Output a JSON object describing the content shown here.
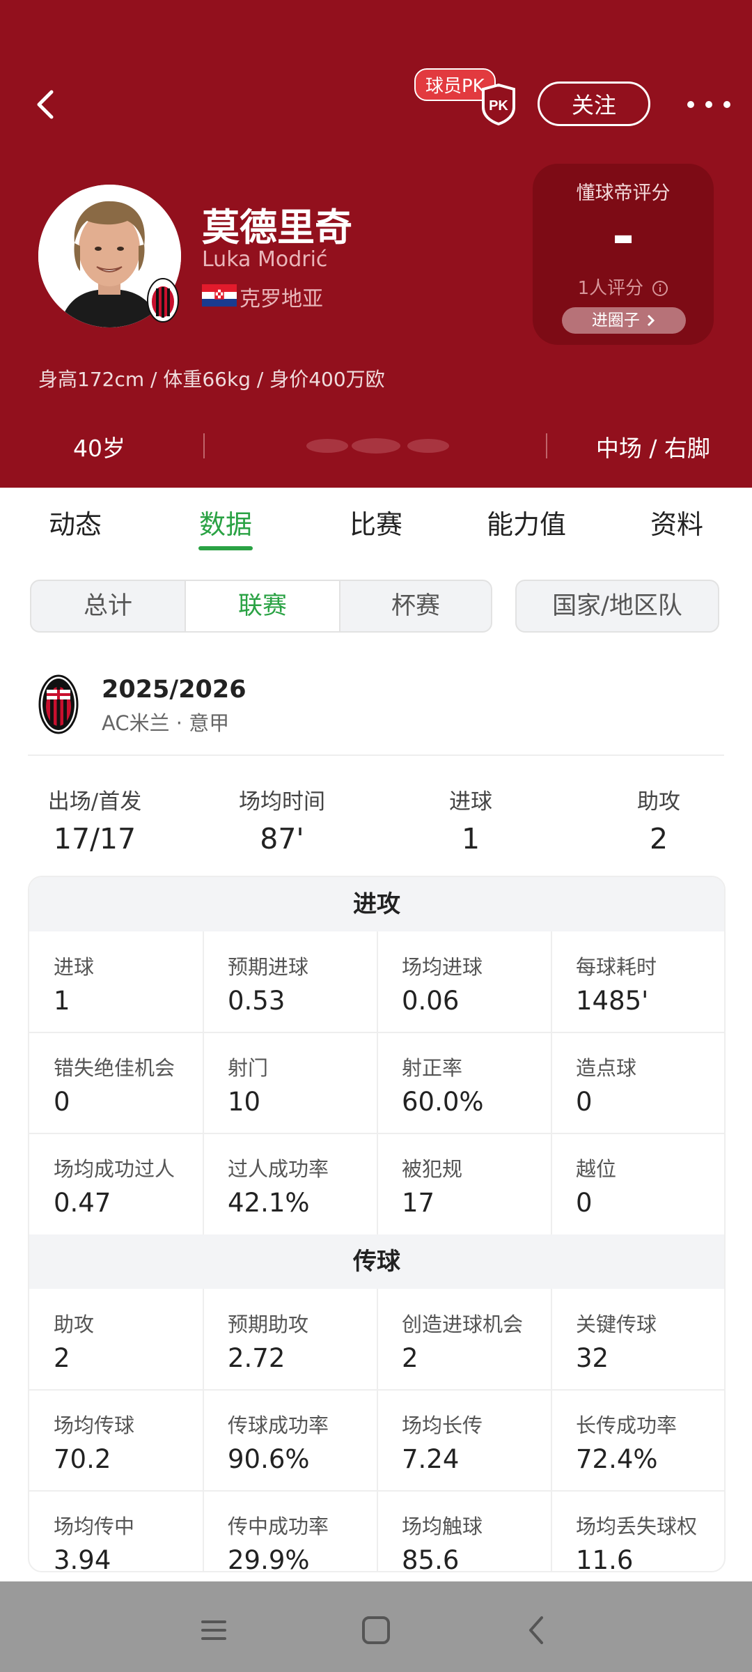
{
  "header": {
    "pk_badge": "球员PK",
    "follow_label": "关注",
    "player_name": "莫德里奇",
    "player_name_en": "Luka Modrić",
    "nationality": "克罗地亚",
    "bio": "身高172cm / 体重66kg / 身价400万欧",
    "age": "40岁",
    "position": "中场 / 右脚",
    "colors": {
      "background": "#92101d",
      "rating_box": "#7d0b15"
    }
  },
  "rating": {
    "title": "懂球帝评分",
    "value": "-",
    "count": "1人评分",
    "button": "进圈子"
  },
  "tabs": [
    {
      "label": "动态"
    },
    {
      "label": "数据",
      "active": true
    },
    {
      "label": "比赛"
    },
    {
      "label": "能力值"
    },
    {
      "label": "资料"
    }
  ],
  "filters": {
    "segments": [
      {
        "label": "总计"
      },
      {
        "label": "联赛",
        "active": true
      },
      {
        "label": "杯赛"
      }
    ],
    "national_team": "国家/地区队"
  },
  "season": {
    "year": "2025/2026",
    "club_league": "AC米兰 · 意甲"
  },
  "summary": [
    {
      "label": "出场/首发",
      "value": "17/17"
    },
    {
      "label": "场均时间",
      "value": "87'"
    },
    {
      "label": "进球",
      "value": "1"
    },
    {
      "label": "助攻",
      "value": "2"
    }
  ],
  "sections": [
    {
      "title": "进攻",
      "stats": [
        {
          "label": "进球",
          "value": "1"
        },
        {
          "label": "预期进球",
          "value": "0.53"
        },
        {
          "label": "场均进球",
          "value": "0.06"
        },
        {
          "label": "每球耗时",
          "value": "1485'"
        },
        {
          "label": "错失绝佳机会",
          "value": "0"
        },
        {
          "label": "射门",
          "value": "10"
        },
        {
          "label": "射正率",
          "value": "60.0%"
        },
        {
          "label": "造点球",
          "value": "0"
        },
        {
          "label": "场均成功过人",
          "value": "0.47"
        },
        {
          "label": "过人成功率",
          "value": "42.1%"
        },
        {
          "label": "被犯规",
          "value": "17"
        },
        {
          "label": "越位",
          "value": "0"
        }
      ]
    },
    {
      "title": "传球",
      "stats": [
        {
          "label": "助攻",
          "value": "2"
        },
        {
          "label": "预期助攻",
          "value": "2.72"
        },
        {
          "label": "创造进球机会",
          "value": "2"
        },
        {
          "label": "关键传球",
          "value": "32"
        },
        {
          "label": "场均传球",
          "value": "70.2"
        },
        {
          "label": "传球成功率",
          "value": "90.6%"
        },
        {
          "label": "场均长传",
          "value": "7.24"
        },
        {
          "label": "长传成功率",
          "value": "72.4%"
        },
        {
          "label": "场均传中",
          "value": "3.94"
        },
        {
          "label": "传中成功率",
          "value": "29.9%"
        },
        {
          "label": "场均触球",
          "value": "85.6"
        },
        {
          "label": "场均丢失球权",
          "value": "11.6"
        }
      ]
    }
  ],
  "navbar": {
    "icons": [
      "menu-icon",
      "home-icon",
      "back-icon"
    ]
  }
}
